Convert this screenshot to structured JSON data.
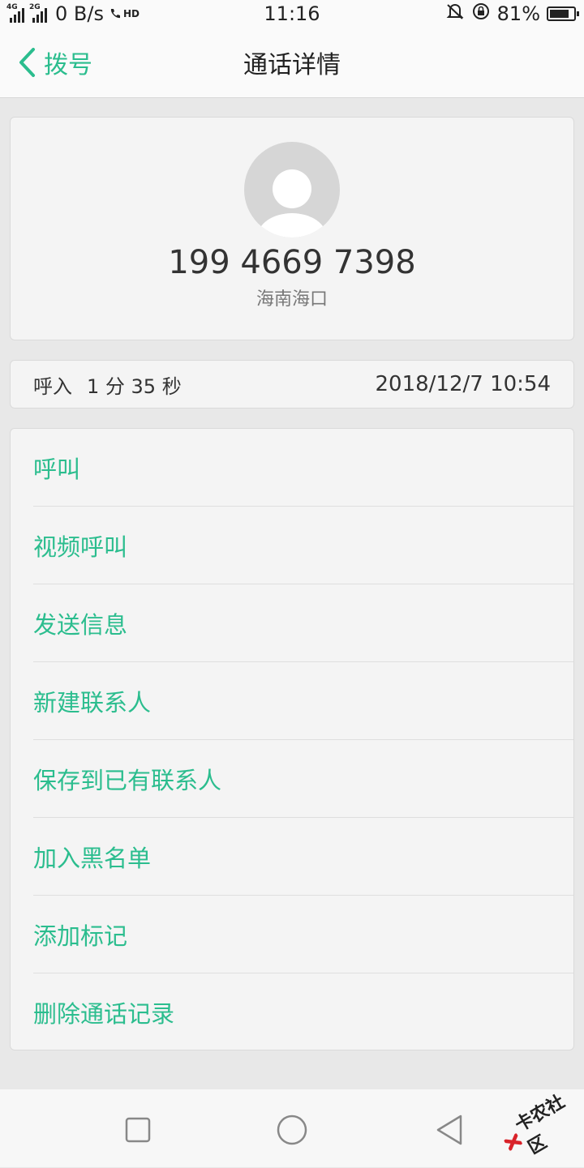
{
  "status_bar": {
    "net_gen_1": "4G",
    "net_gen_2": "2G",
    "speed": "0 B/s",
    "hd": "HD",
    "time": "11:16",
    "battery": "81%",
    "battery_level": 0.81
  },
  "header": {
    "back_label": "拨号",
    "title": "通话详情"
  },
  "contact": {
    "number": "199 4669 7398",
    "location": "海南海口"
  },
  "call_info": {
    "direction": "呼入",
    "duration": "1 分 35 秒",
    "datetime": "2018/12/7 10:54"
  },
  "actions": [
    {
      "label": "呼叫"
    },
    {
      "label": "视频呼叫"
    },
    {
      "label": "发送信息"
    },
    {
      "label": "新建联系人"
    },
    {
      "label": "保存到已有联系人"
    },
    {
      "label": "加入黑名单"
    },
    {
      "label": "添加标记"
    },
    {
      "label": "删除通话记录"
    }
  ],
  "watermark": "卡农社区",
  "colors": {
    "accent": "#2bbd8e",
    "background": "#e8e8e8",
    "card": "#f4f4f4"
  }
}
